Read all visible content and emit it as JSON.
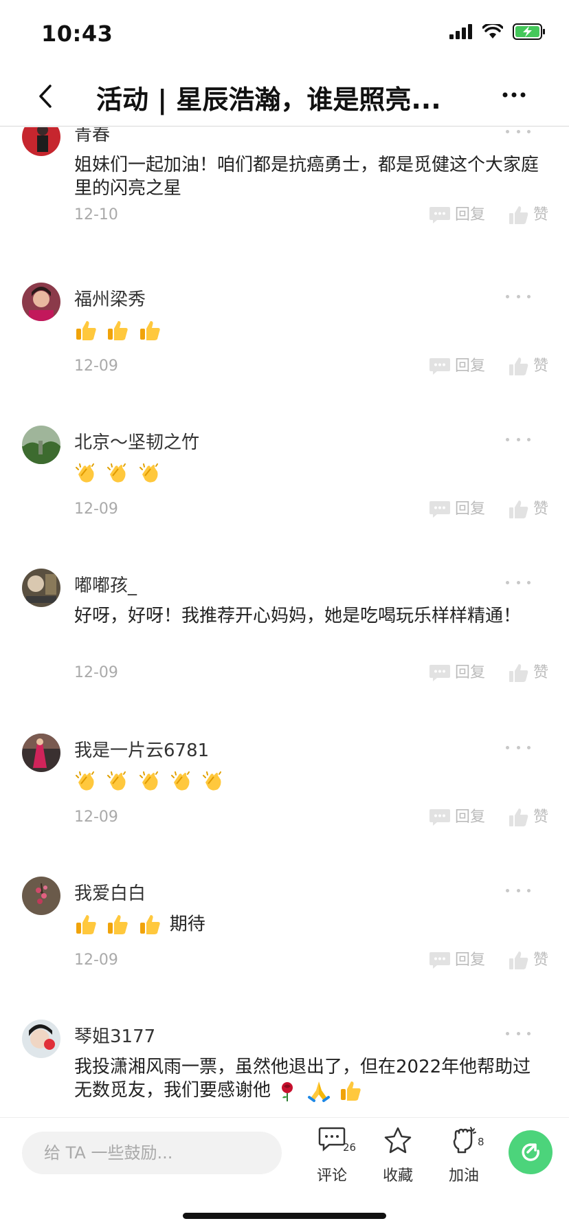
{
  "status_bar": {
    "time": "10:43"
  },
  "nav": {
    "title": "活动 | 星辰浩瀚，谁是照亮..."
  },
  "actions": {
    "reply_label": "回复",
    "like_label": "赞"
  },
  "comments": [
    {
      "name": "青春",
      "text": "姐妹们一起加油！咱们都是抗癌勇士，都是觅健这个大家庭里的闪亮之星",
      "date": "12-10",
      "emojis": []
    },
    {
      "name": "福州梁秀",
      "text": "",
      "date": "12-09",
      "emojis": [
        "thumbs-up",
        "thumbs-up",
        "thumbs-up"
      ]
    },
    {
      "name": "北京～坚韧之竹",
      "text": "",
      "date": "12-09",
      "emojis": [
        "clapping-hands",
        "clapping-hands",
        "clapping-hands"
      ]
    },
    {
      "name": "嘟嘟孩_",
      "text": "好呀，好呀！我推荐开心妈妈，她是吃喝玩乐样样精通！",
      "date": "12-09",
      "emojis": []
    },
    {
      "name": "我是一片云6781",
      "text": "",
      "date": "12-09",
      "emojis": [
        "clapping-hands",
        "clapping-hands",
        "clapping-hands",
        "clapping-hands",
        "clapping-hands"
      ]
    },
    {
      "name": "我爱白白",
      "text": "期待",
      "date": "12-09",
      "emojis": [
        "thumbs-up",
        "thumbs-up",
        "thumbs-up"
      ]
    },
    {
      "name": "琴姐3177",
      "text": "我投潇湘风雨一票，虽然他退出了，但在2022年他帮助过无数觅友，我们要感谢他",
      "date": "",
      "emojis": [
        "rose",
        "folded-hands",
        "thumbs-up"
      ]
    }
  ],
  "bottom_bar": {
    "input_placeholder": "给 TA 一些鼓励...",
    "comment_label": "评论",
    "comment_count": "26",
    "favorite_label": "收藏",
    "cheer_label": "加油",
    "cheer_count": "8"
  }
}
